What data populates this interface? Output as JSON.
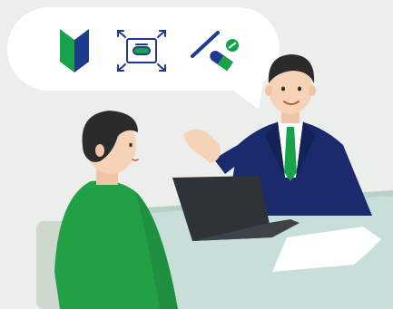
{
  "scene": {
    "speech_bubble": {
      "icons": [
        "beginner-mark-icon",
        "tablet-zoom-icon",
        "medicine-pill-icon"
      ]
    },
    "colors": {
      "background": "#eceeec",
      "bubble": "#ffffff",
      "beginner_green": "#16a34a",
      "beginner_blue": "#1e3a8a",
      "icon_blue": "#1f3a93",
      "suit_navy": "#1a2a6c",
      "tie_green": "#16a34a",
      "sweater_green": "#22a046",
      "hair": "#2b2b2b",
      "skin": "#f6d3b6",
      "desk": "#c7ded9",
      "laptop": "#2e3338",
      "chair": "#cdd9cf"
    }
  }
}
